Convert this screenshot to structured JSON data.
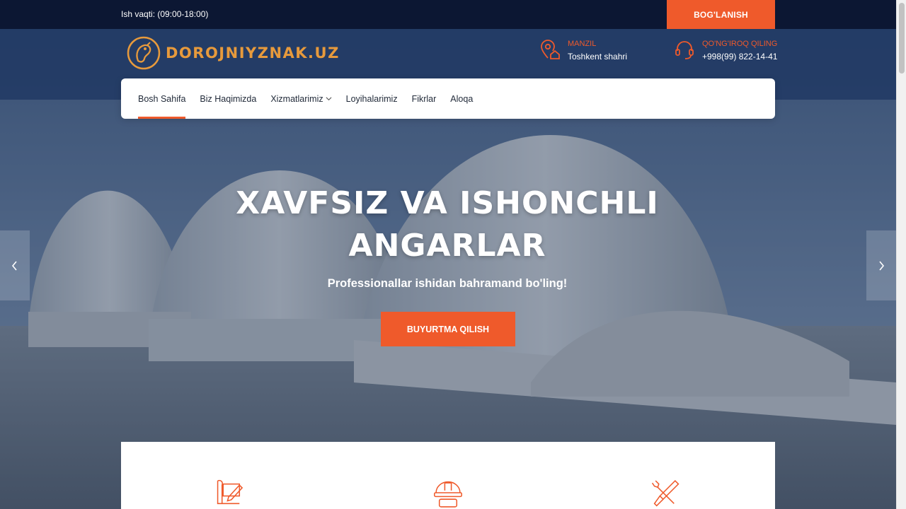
{
  "topbar": {
    "hours": "Ish vaqti: (09:00-18:00)",
    "contact_button": "BOG'LANISH"
  },
  "header": {
    "logo_text": "DOROJNIYZNAK.UZ",
    "logo_icon": "owl-logo-icon",
    "address": {
      "label": "MANZIL",
      "value": "Toshkent shahri",
      "icon": "location-home-icon"
    },
    "phone": {
      "label": "QO'NG'IROQ QILING",
      "value": "+998(99) 822-14-41",
      "icon": "headset-icon"
    }
  },
  "nav": {
    "items": [
      {
        "label": "Bosh Sahifa",
        "active": true
      },
      {
        "label": "Biz Haqimizda"
      },
      {
        "label": "Xizmatlarimiz",
        "dropdown": true
      },
      {
        "label": "Loyihalarimiz"
      },
      {
        "label": "Fikrlar"
      },
      {
        "label": "Aloqa"
      }
    ]
  },
  "hero": {
    "title_line1": "XAVFSIZ VA ISHONCHLI",
    "title_line2": "ANGARLAR",
    "subtitle": "Professionallar ishidan bahramand bo'ling!",
    "cta_label": "BUYURTMA QILISH"
  },
  "features": {
    "icons": [
      "blueprint-pencil-icon",
      "hard-hat-icon",
      "wrench-screwdriver-icon"
    ]
  },
  "colors": {
    "accent": "#ef5a2b",
    "topbar": "#0c1733",
    "logo": "#e79a3c"
  }
}
